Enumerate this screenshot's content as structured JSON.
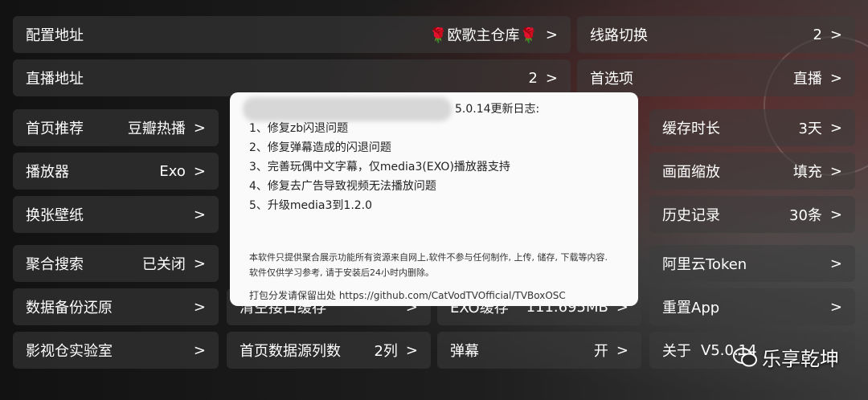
{
  "settings": {
    "config_address": {
      "label": "配置地址",
      "value": "🌹欧歌主仓库🌹"
    },
    "line_switch": {
      "label": "线路切换",
      "value": "2"
    },
    "live_address": {
      "label": "直播地址",
      "value": "2"
    },
    "preferred": {
      "label": "首选项",
      "value": "直播"
    },
    "home_recommend": {
      "label": "首页推荐",
      "value": "豆瓣热播"
    },
    "cache_duration": {
      "label": "缓存时长",
      "value": "3天"
    },
    "player": {
      "label": "播放器",
      "value": "Exo"
    },
    "display_scale": {
      "label": "画面缩放",
      "value": "填充"
    },
    "wallpaper": {
      "label": "换张壁纸"
    },
    "history": {
      "label": "历史记录",
      "value": "30条"
    },
    "aggregate_search": {
      "label": "聚合搜索",
      "value": "已关闭"
    },
    "aliyun_token": {
      "label": "阿里云Token"
    },
    "data_backup": {
      "label": "数据备份还原"
    },
    "clear_api_cache": {
      "label": "清空接口缓存"
    },
    "exo_cache": {
      "label": "EXO缓存",
      "value": "111.695MB"
    },
    "reset_app": {
      "label": "重置App"
    },
    "lab": {
      "label": "影视仓实验室"
    },
    "home_columns": {
      "label": "首页数据源列数",
      "value": "2列"
    },
    "danmaku": {
      "label": "弹幕",
      "value": "开"
    },
    "about": {
      "label": "关于",
      "value": "V5.0.14"
    }
  },
  "chevron": ">",
  "dialog": {
    "title": "5.0.14更新日志:",
    "items": [
      "1、修复zb闪退问题",
      "2、修复弹幕造成的闪退问题",
      "3、完善玩偶中文字幕，仅media3(EXO)播放器支持",
      "4、修复去广告导致视频无法播放问题",
      "5、升级media3到1.2.0"
    ],
    "disclaimer": "本软件只提供聚合展示功能所有资源来自网上,软件不参与任何制作, 上传, 储存, 下载等内容. 软件仅供学习参考, 请于安装后24小时内删除。",
    "source": "打包分发请保留出处  https://github.com/CatVodTVOfficial/TVBoxOSC"
  },
  "watermark": {
    "text": "乐享乾坤",
    "icon": "wechat-icon"
  }
}
